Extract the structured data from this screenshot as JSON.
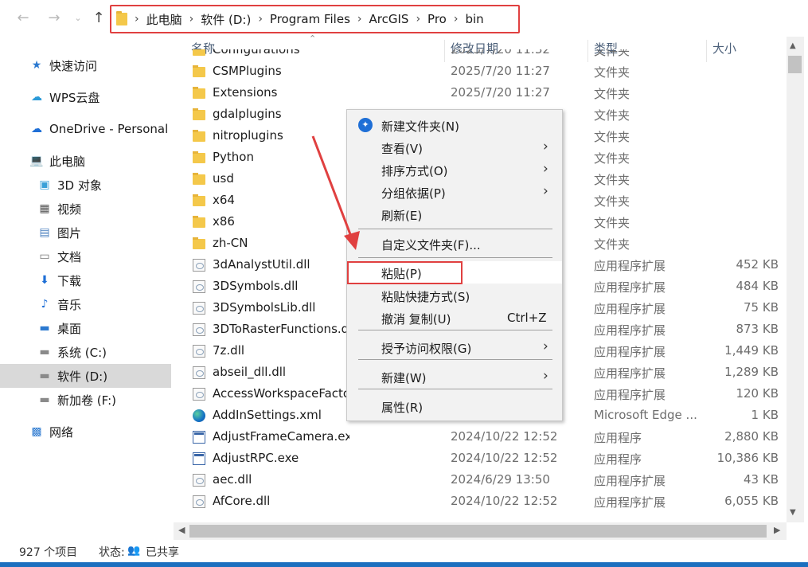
{
  "nav": {
    "back_icon": "arrow-left-icon",
    "forward_icon": "arrow-right-icon",
    "recent_icon": "chevron-down-icon",
    "up_icon": "arrow-up-icon"
  },
  "breadcrumb": [
    "此电脑",
    "软件 (D:)",
    "Program Files",
    "ArcGIS",
    "Pro",
    "bin"
  ],
  "sidebar": {
    "items": [
      {
        "label": "快速访问",
        "icon": "star-icon"
      },
      {
        "label": "WPS云盘",
        "icon": "cloud-icon"
      },
      {
        "label": "OneDrive - Personal",
        "icon": "onedrive-icon"
      },
      {
        "label": "此电脑",
        "icon": "computer-icon"
      },
      {
        "label": "3D 对象",
        "icon": "cube-icon"
      },
      {
        "label": "视频",
        "icon": "film-icon"
      },
      {
        "label": "图片",
        "icon": "picture-icon"
      },
      {
        "label": "文档",
        "icon": "document-icon"
      },
      {
        "label": "下载",
        "icon": "download-icon"
      },
      {
        "label": "音乐",
        "icon": "music-icon"
      },
      {
        "label": "桌面",
        "icon": "desktop-icon"
      },
      {
        "label": "系统 (C:)",
        "icon": "drive-icon"
      },
      {
        "label": "软件 (D:)",
        "icon": "drive-icon"
      },
      {
        "label": "新加卷 (F:)",
        "icon": "drive-icon"
      },
      {
        "label": "网络",
        "icon": "network-icon"
      }
    ]
  },
  "columns": {
    "name": "名称",
    "date": "修改日期",
    "type": "类型",
    "size": "大小"
  },
  "files": [
    {
      "name": "Configurations",
      "date": "2025/7/20 11:32",
      "type": "文件夹",
      "size": "",
      "kind": "folder"
    },
    {
      "name": "CSMPlugins",
      "date": "2025/7/20 11:27",
      "type": "文件夹",
      "size": "",
      "kind": "folder"
    },
    {
      "name": "Extensions",
      "date": "2025/7/20 11:27",
      "type": "文件夹",
      "size": "",
      "kind": "folder"
    },
    {
      "name": "gdalplugins",
      "date": "",
      "type": "文件夹",
      "size": "",
      "kind": "folder"
    },
    {
      "name": "nitroplugins",
      "date": "",
      "type": "文件夹",
      "size": "",
      "kind": "folder"
    },
    {
      "name": "Python",
      "date": "",
      "type": "文件夹",
      "size": "",
      "kind": "folder"
    },
    {
      "name": "usd",
      "date": "",
      "type": "文件夹",
      "size": "",
      "kind": "folder"
    },
    {
      "name": "x64",
      "date": "",
      "type": "文件夹",
      "size": "",
      "kind": "folder"
    },
    {
      "name": "x86",
      "date": "",
      "type": "文件夹",
      "size": "",
      "kind": "folder"
    },
    {
      "name": "zh-CN",
      "date": "",
      "type": "文件夹",
      "size": "",
      "kind": "folder"
    },
    {
      "name": "3dAnalystUtil.dll",
      "date": "",
      "type": "应用程序扩展",
      "size": "452 KB",
      "kind": "dll"
    },
    {
      "name": "3DSymbols.dll",
      "date": "",
      "type": "应用程序扩展",
      "size": "484 KB",
      "kind": "dll"
    },
    {
      "name": "3DSymbolsLib.dll",
      "date": "",
      "type": "应用程序扩展",
      "size": "75 KB",
      "kind": "dll"
    },
    {
      "name": "3DToRasterFunctions.d",
      "date": "",
      "type": "应用程序扩展",
      "size": "873 KB",
      "kind": "dll"
    },
    {
      "name": "7z.dll",
      "date": "",
      "type": "应用程序扩展",
      "size": "1,449 KB",
      "kind": "dll"
    },
    {
      "name": "abseil_dll.dll",
      "date": "",
      "type": "应用程序扩展",
      "size": "1,289 KB",
      "kind": "dll"
    },
    {
      "name": "AccessWorkspaceFacto",
      "date": "",
      "type": "应用程序扩展",
      "size": "120 KB",
      "kind": "dll"
    },
    {
      "name": "AddInSettings.xml",
      "date": "2024/10/21 12:15",
      "type": "Microsoft Edge ...",
      "size": "1 KB",
      "kind": "edge"
    },
    {
      "name": "AdjustFrameCamera.exe",
      "date": "2024/10/22 12:52",
      "type": "应用程序",
      "size": "2,880 KB",
      "kind": "exe"
    },
    {
      "name": "AdjustRPC.exe",
      "date": "2024/10/22 12:52",
      "type": "应用程序",
      "size": "10,386 KB",
      "kind": "exe"
    },
    {
      "name": "aec.dll",
      "date": "2024/6/29 13:50",
      "type": "应用程序扩展",
      "size": "43 KB",
      "kind": "dll"
    },
    {
      "name": "AfCore.dll",
      "date": "2024/10/22 12:52",
      "type": "应用程序扩展",
      "size": "6,055 KB",
      "kind": "dll"
    }
  ],
  "context_menu": {
    "items": [
      {
        "label": "新建文件夹(N)",
        "shortcut": "",
        "submenu": false,
        "icon": "new-folder-icon"
      },
      {
        "label": "查看(V)",
        "shortcut": "",
        "submenu": true
      },
      {
        "label": "排序方式(O)",
        "shortcut": "",
        "submenu": true
      },
      {
        "label": "分组依据(P)",
        "shortcut": "",
        "submenu": true
      },
      {
        "label": "刷新(E)",
        "shortcut": "",
        "submenu": false
      },
      {
        "label": "自定义文件夹(F)...",
        "shortcut": "",
        "submenu": false
      },
      {
        "label": "粘贴(P)",
        "shortcut": "",
        "submenu": false
      },
      {
        "label": "粘贴快捷方式(S)",
        "shortcut": "",
        "submenu": false
      },
      {
        "label": "撤消 复制(U)",
        "shortcut": "Ctrl+Z",
        "submenu": false
      },
      {
        "label": "授予访问权限(G)",
        "shortcut": "",
        "submenu": true
      },
      {
        "label": "新建(W)",
        "shortcut": "",
        "submenu": true
      },
      {
        "label": "属性(R)",
        "shortcut": "",
        "submenu": false
      }
    ]
  },
  "status": {
    "item_count": "927 个项目",
    "state_label": "状态:",
    "shared": "已共享",
    "shared_icon": "shared-users-icon"
  },
  "colors": {
    "highlight_box": "#e04040",
    "accent": "#1b6fbf",
    "selected_sidebar": "#d9d9d9"
  }
}
